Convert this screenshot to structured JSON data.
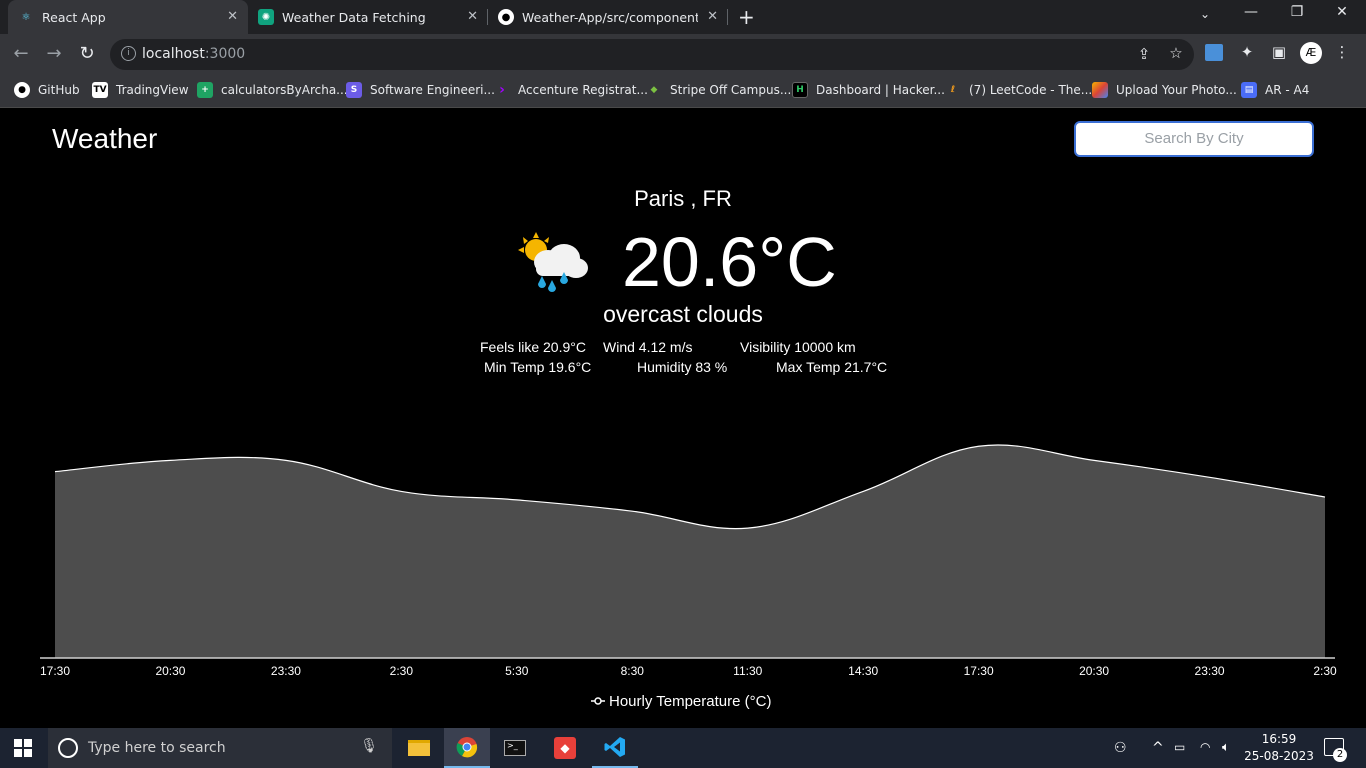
{
  "browser": {
    "tabs": [
      {
        "title": "React App",
        "icon": "react-icon"
      },
      {
        "title": "Weather Data Fetching",
        "icon": "chatgpt-icon"
      },
      {
        "title": "Weather-App/src/components/D",
        "icon": "github-icon"
      }
    ],
    "url_host": "localhost",
    "url_port": ":3000",
    "bookmarks": [
      {
        "label": "GitHub",
        "icon": "github-icon"
      },
      {
        "label": "TradingView",
        "icon": "tradingview-icon"
      },
      {
        "label": "calculatorsByArcha...",
        "icon": "sheets-icon"
      },
      {
        "label": "Software Engineeri...",
        "icon": "s-icon"
      },
      {
        "label": "Accenture Registrat...",
        "icon": "accenture-icon"
      },
      {
        "label": "Stripe Off Campus...",
        "icon": "bird-icon"
      },
      {
        "label": "Dashboard | Hacker...",
        "icon": "hackerrank-icon"
      },
      {
        "label": "(7) LeetCode - The...",
        "icon": "leetcode-icon"
      },
      {
        "label": "Upload Your Photo...",
        "icon": "photo-icon"
      },
      {
        "label": "AR - A4",
        "icon": "printer-icon"
      }
    ]
  },
  "app": {
    "title": "Weather",
    "search_placeholder": "Search By City",
    "city": "Paris , FR",
    "temperature": "20.6°C",
    "description": "overcast clouds",
    "feels_like": "Feels like 20.9°C",
    "wind": "Wind 4.12 m/s",
    "visibility": "Visibility 10000 km",
    "min_temp": "Min Temp 19.6°C",
    "humidity": "Humidity 83 %",
    "max_temp": "Max Temp 21.7°C"
  },
  "chart_data": {
    "type": "area",
    "categories": [
      "17:30",
      "20:30",
      "23:30",
      "2:30",
      "5:30",
      "8:30",
      "11:30",
      "14:30",
      "17:30",
      "20:30",
      "23:30",
      "2:30"
    ],
    "series": [
      {
        "name": "Hourly Temperature (°C)",
        "values": [
          20.6,
          21.0,
          21.0,
          19.9,
          19.6,
          19.2,
          18.6,
          19.9,
          21.5,
          21.0,
          20.4,
          19.7
        ]
      }
    ],
    "ylim": [
      14,
      22.5
    ],
    "legend": "bottom",
    "fill_color": "#4d4d4d",
    "line_color": "#ffffff"
  },
  "taskbar": {
    "search_placeholder": "Type here to search",
    "time": "16:59",
    "date": "25-08-2023",
    "notifications": "2"
  }
}
